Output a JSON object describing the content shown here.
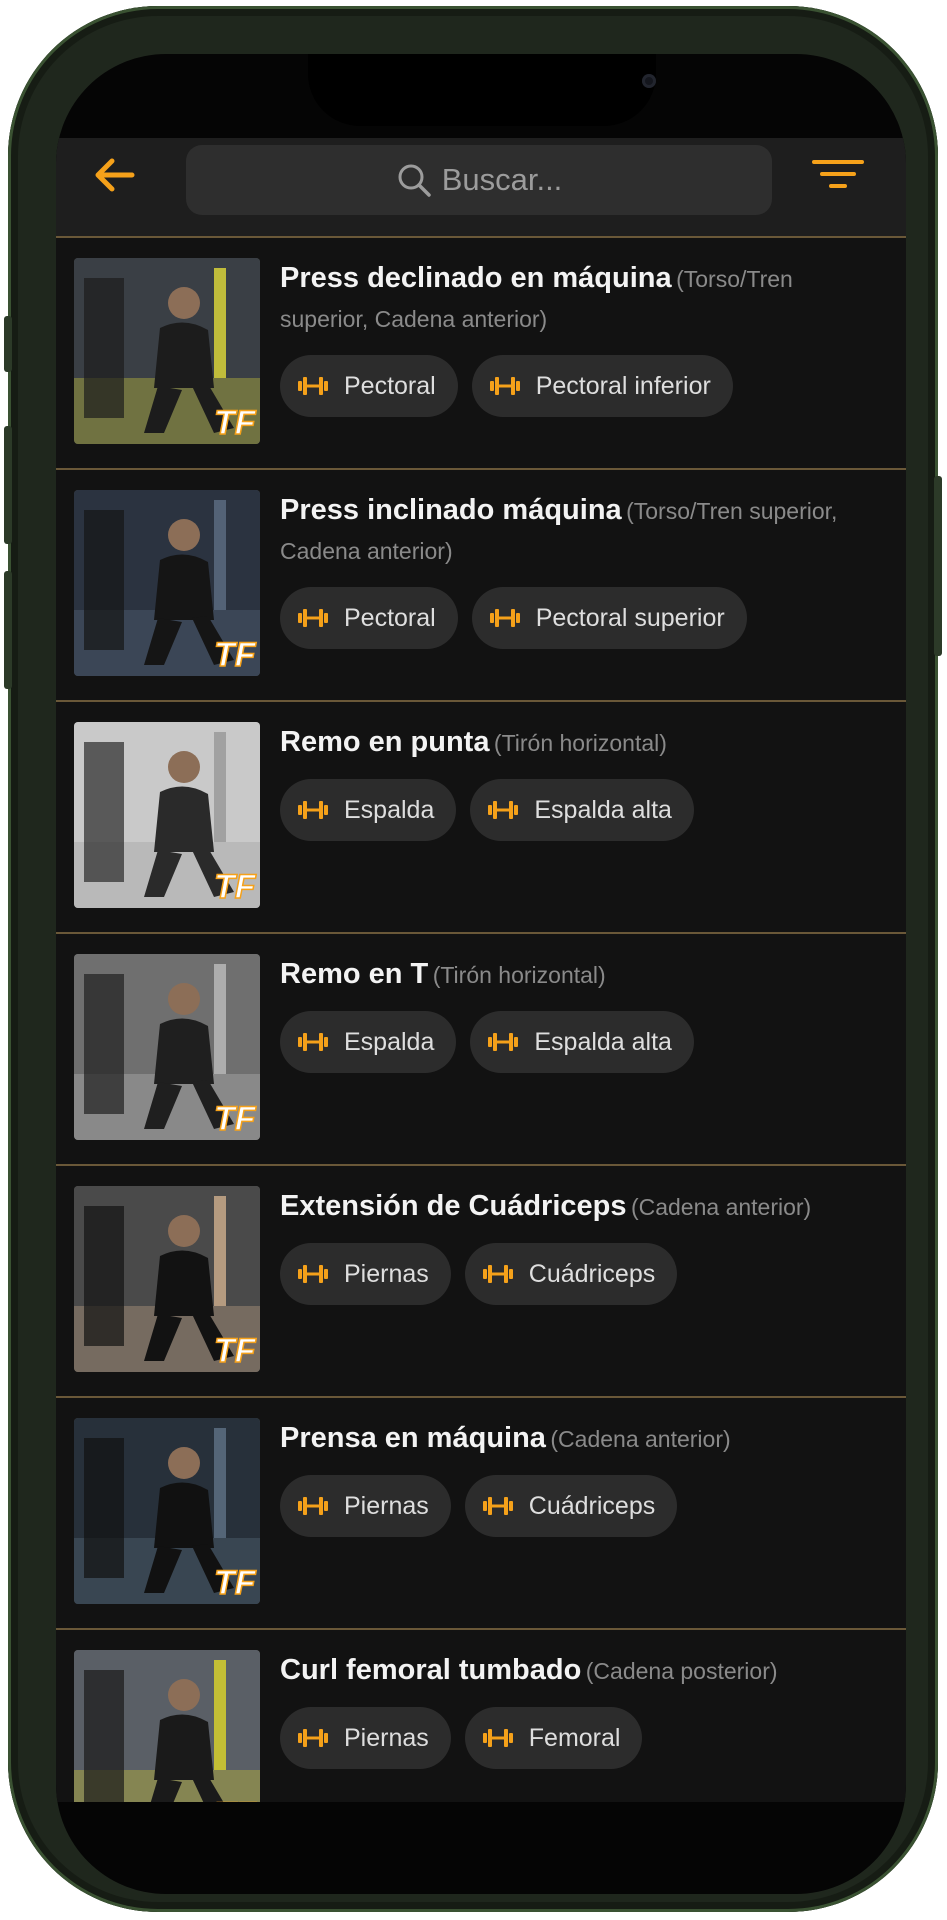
{
  "header": {
    "search_placeholder": "Buscar..."
  },
  "colors": {
    "accent": "#f5a11a",
    "background": "#121212",
    "header": "#1e1e1e",
    "chip": "#2c2c2c",
    "separator": "#6a5838"
  },
  "icons": {
    "back": "arrow-left-icon",
    "search": "search-icon",
    "filter": "filter-icon",
    "muscle": "dumbbell-icon",
    "thumbnail_logo": "TF"
  },
  "exercises": [
    {
      "name": "Press declinado en máquina",
      "category": "(Torso/Tren superior, Cadena anterior)",
      "muscles": [
        "Pectoral",
        "Pectoral inferior"
      ]
    },
    {
      "name": "Press inclinado máquina",
      "category": "(Torso/Tren superior, Cadena anterior)",
      "muscles": [
        "Pectoral",
        "Pectoral superior"
      ]
    },
    {
      "name": "Remo en punta",
      "category": "(Tirón horizontal)",
      "muscles": [
        "Espalda",
        "Espalda alta"
      ]
    },
    {
      "name": "Remo en T",
      "category": "(Tirón horizontal)",
      "muscles": [
        "Espalda",
        "Espalda alta"
      ]
    },
    {
      "name": "Extensión de Cuádriceps",
      "category": "(Cadena anterior)",
      "muscles": [
        "Piernas",
        "Cuádriceps"
      ]
    },
    {
      "name": "Prensa en máquina",
      "category": "(Cadena anterior)",
      "muscles": [
        "Piernas",
        "Cuádriceps"
      ]
    },
    {
      "name": "Curl femoral tumbado",
      "category": "(Cadena posterior)",
      "muscles": [
        "Piernas",
        "Femoral"
      ]
    }
  ]
}
